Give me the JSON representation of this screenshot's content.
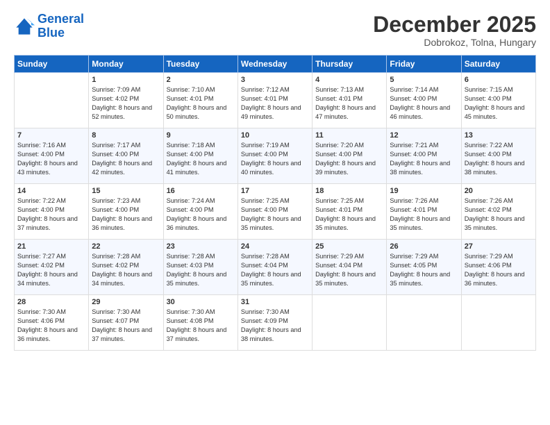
{
  "logo": {
    "line1": "General",
    "line2": "Blue"
  },
  "title": "December 2025",
  "subtitle": "Dobrokoz, Tolna, Hungary",
  "header_days": [
    "Sunday",
    "Monday",
    "Tuesday",
    "Wednesday",
    "Thursday",
    "Friday",
    "Saturday"
  ],
  "weeks": [
    [
      {
        "num": "",
        "sunrise": "",
        "sunset": "",
        "daylight": ""
      },
      {
        "num": "1",
        "sunrise": "Sunrise: 7:09 AM",
        "sunset": "Sunset: 4:02 PM",
        "daylight": "Daylight: 8 hours and 52 minutes."
      },
      {
        "num": "2",
        "sunrise": "Sunrise: 7:10 AM",
        "sunset": "Sunset: 4:01 PM",
        "daylight": "Daylight: 8 hours and 50 minutes."
      },
      {
        "num": "3",
        "sunrise": "Sunrise: 7:12 AM",
        "sunset": "Sunset: 4:01 PM",
        "daylight": "Daylight: 8 hours and 49 minutes."
      },
      {
        "num": "4",
        "sunrise": "Sunrise: 7:13 AM",
        "sunset": "Sunset: 4:01 PM",
        "daylight": "Daylight: 8 hours and 47 minutes."
      },
      {
        "num": "5",
        "sunrise": "Sunrise: 7:14 AM",
        "sunset": "Sunset: 4:00 PM",
        "daylight": "Daylight: 8 hours and 46 minutes."
      },
      {
        "num": "6",
        "sunrise": "Sunrise: 7:15 AM",
        "sunset": "Sunset: 4:00 PM",
        "daylight": "Daylight: 8 hours and 45 minutes."
      }
    ],
    [
      {
        "num": "7",
        "sunrise": "Sunrise: 7:16 AM",
        "sunset": "Sunset: 4:00 PM",
        "daylight": "Daylight: 8 hours and 43 minutes."
      },
      {
        "num": "8",
        "sunrise": "Sunrise: 7:17 AM",
        "sunset": "Sunset: 4:00 PM",
        "daylight": "Daylight: 8 hours and 42 minutes."
      },
      {
        "num": "9",
        "sunrise": "Sunrise: 7:18 AM",
        "sunset": "Sunset: 4:00 PM",
        "daylight": "Daylight: 8 hours and 41 minutes."
      },
      {
        "num": "10",
        "sunrise": "Sunrise: 7:19 AM",
        "sunset": "Sunset: 4:00 PM",
        "daylight": "Daylight: 8 hours and 40 minutes."
      },
      {
        "num": "11",
        "sunrise": "Sunrise: 7:20 AM",
        "sunset": "Sunset: 4:00 PM",
        "daylight": "Daylight: 8 hours and 39 minutes."
      },
      {
        "num": "12",
        "sunrise": "Sunrise: 7:21 AM",
        "sunset": "Sunset: 4:00 PM",
        "daylight": "Daylight: 8 hours and 38 minutes."
      },
      {
        "num": "13",
        "sunrise": "Sunrise: 7:22 AM",
        "sunset": "Sunset: 4:00 PM",
        "daylight": "Daylight: 8 hours and 38 minutes."
      }
    ],
    [
      {
        "num": "14",
        "sunrise": "Sunrise: 7:22 AM",
        "sunset": "Sunset: 4:00 PM",
        "daylight": "Daylight: 8 hours and 37 minutes."
      },
      {
        "num": "15",
        "sunrise": "Sunrise: 7:23 AM",
        "sunset": "Sunset: 4:00 PM",
        "daylight": "Daylight: 8 hours and 36 minutes."
      },
      {
        "num": "16",
        "sunrise": "Sunrise: 7:24 AM",
        "sunset": "Sunset: 4:00 PM",
        "daylight": "Daylight: 8 hours and 36 minutes."
      },
      {
        "num": "17",
        "sunrise": "Sunrise: 7:25 AM",
        "sunset": "Sunset: 4:00 PM",
        "daylight": "Daylight: 8 hours and 35 minutes."
      },
      {
        "num": "18",
        "sunrise": "Sunrise: 7:25 AM",
        "sunset": "Sunset: 4:01 PM",
        "daylight": "Daylight: 8 hours and 35 minutes."
      },
      {
        "num": "19",
        "sunrise": "Sunrise: 7:26 AM",
        "sunset": "Sunset: 4:01 PM",
        "daylight": "Daylight: 8 hours and 35 minutes."
      },
      {
        "num": "20",
        "sunrise": "Sunrise: 7:26 AM",
        "sunset": "Sunset: 4:02 PM",
        "daylight": "Daylight: 8 hours and 35 minutes."
      }
    ],
    [
      {
        "num": "21",
        "sunrise": "Sunrise: 7:27 AM",
        "sunset": "Sunset: 4:02 PM",
        "daylight": "Daylight: 8 hours and 34 minutes."
      },
      {
        "num": "22",
        "sunrise": "Sunrise: 7:28 AM",
        "sunset": "Sunset: 4:02 PM",
        "daylight": "Daylight: 8 hours and 34 minutes."
      },
      {
        "num": "23",
        "sunrise": "Sunrise: 7:28 AM",
        "sunset": "Sunset: 4:03 PM",
        "daylight": "Daylight: 8 hours and 35 minutes."
      },
      {
        "num": "24",
        "sunrise": "Sunrise: 7:28 AM",
        "sunset": "Sunset: 4:04 PM",
        "daylight": "Daylight: 8 hours and 35 minutes."
      },
      {
        "num": "25",
        "sunrise": "Sunrise: 7:29 AM",
        "sunset": "Sunset: 4:04 PM",
        "daylight": "Daylight: 8 hours and 35 minutes."
      },
      {
        "num": "26",
        "sunrise": "Sunrise: 7:29 AM",
        "sunset": "Sunset: 4:05 PM",
        "daylight": "Daylight: 8 hours and 35 minutes."
      },
      {
        "num": "27",
        "sunrise": "Sunrise: 7:29 AM",
        "sunset": "Sunset: 4:06 PM",
        "daylight": "Daylight: 8 hours and 36 minutes."
      }
    ],
    [
      {
        "num": "28",
        "sunrise": "Sunrise: 7:30 AM",
        "sunset": "Sunset: 4:06 PM",
        "daylight": "Daylight: 8 hours and 36 minutes."
      },
      {
        "num": "29",
        "sunrise": "Sunrise: 7:30 AM",
        "sunset": "Sunset: 4:07 PM",
        "daylight": "Daylight: 8 hours and 37 minutes."
      },
      {
        "num": "30",
        "sunrise": "Sunrise: 7:30 AM",
        "sunset": "Sunset: 4:08 PM",
        "daylight": "Daylight: 8 hours and 37 minutes."
      },
      {
        "num": "31",
        "sunrise": "Sunrise: 7:30 AM",
        "sunset": "Sunset: 4:09 PM",
        "daylight": "Daylight: 8 hours and 38 minutes."
      },
      {
        "num": "",
        "sunrise": "",
        "sunset": "",
        "daylight": ""
      },
      {
        "num": "",
        "sunrise": "",
        "sunset": "",
        "daylight": ""
      },
      {
        "num": "",
        "sunrise": "",
        "sunset": "",
        "daylight": ""
      }
    ]
  ]
}
